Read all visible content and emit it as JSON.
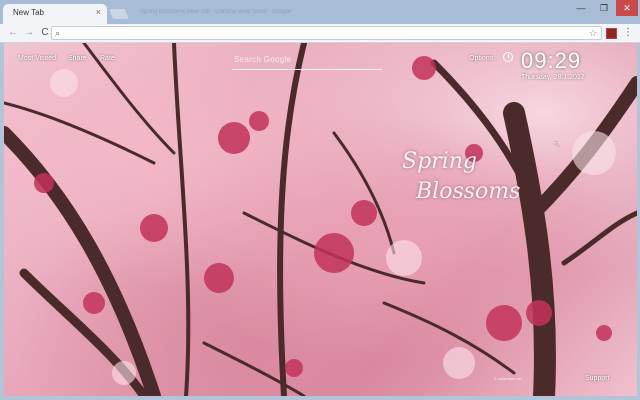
{
  "browser": {
    "tab_title": "New Tab",
    "tab_close": "×",
    "ghost_tabs": "Spring Blossoms New Tab · Chrome Web Store · Google",
    "window": {
      "minimize": "—",
      "maximize": "❐",
      "close": "✕"
    },
    "nav": {
      "back": "←",
      "forward": "→",
      "reload": "C"
    },
    "omnibox": {
      "value": "",
      "search_icon": "⌕",
      "star_icon": "☆"
    },
    "menu_icon": "⋮"
  },
  "newtab": {
    "most_visited": "Most Visited",
    "share": "Share",
    "rate": "Rate",
    "search_placeholder": "Search Google",
    "options": "Options",
    "time": "09:29",
    "date": "Thursday, 28.1.2017",
    "title_line1": "Spring",
    "title_line2": "Blossoms",
    "credit": "© www.fanc.net",
    "support": "Support"
  },
  "colors": {
    "accent_text": "#ffffff",
    "blossom_pink": "#e7a4b7",
    "branch": "#4a2a2a"
  }
}
